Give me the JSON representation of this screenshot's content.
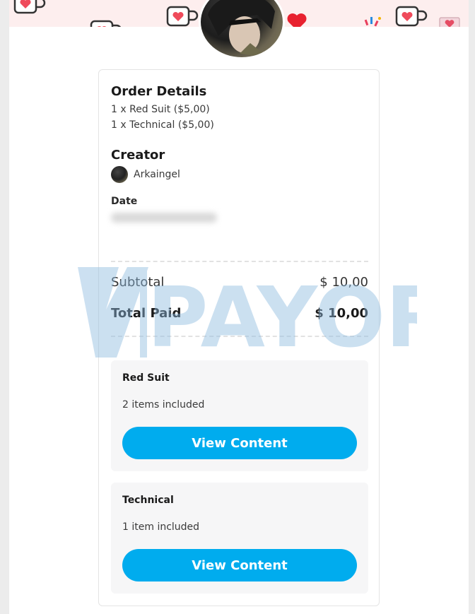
{
  "order": {
    "heading": "Order Details",
    "items": [
      "1 x Red Suit ($5,00)",
      "1 x Technical ($5,00)"
    ]
  },
  "creator": {
    "heading": "Creator",
    "name": "Arkaingel"
  },
  "date": {
    "label": "Date"
  },
  "summary": {
    "subtotal_label": "Subtotal",
    "subtotal_value": "$ 10,00",
    "total_label": "Total Paid",
    "total_value": "$ 10,00"
  },
  "watermark": {
    "text": "PAYOR"
  },
  "packages": [
    {
      "title": "Red Suit",
      "count": "2 items included",
      "button": "View Content"
    },
    {
      "title": "Technical",
      "count": "1 item included",
      "button": "View Content"
    }
  ],
  "colors": {
    "accent": "#00acee",
    "banner": "#fdeeee",
    "watermark": "#9fc6e6"
  },
  "icons": [
    "coffee-mug-heart-icon",
    "heart-icon",
    "confetti-icon",
    "envelope-heart-icon"
  ]
}
